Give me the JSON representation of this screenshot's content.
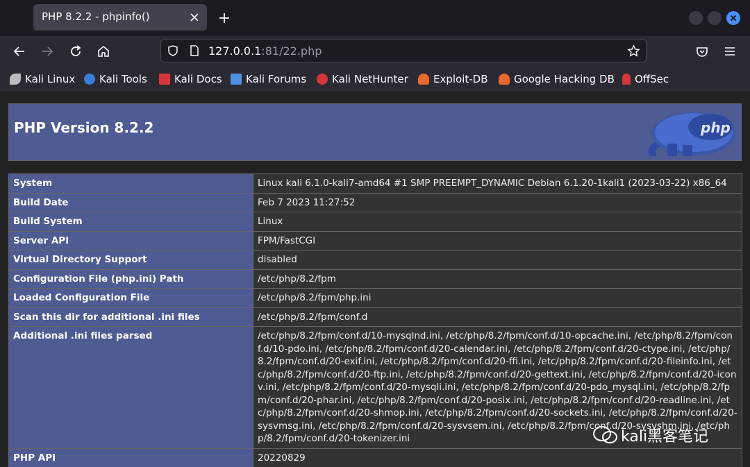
{
  "browser": {
    "tab_title": "PHP 8.2.2 - phpinfo()",
    "url_host": "127.0.0.1",
    "url_rest": ":81/22.php"
  },
  "bookmarks": [
    {
      "label": "Kali Linux",
      "icon": "kali-dragon-icon",
      "color": "#cccccc"
    },
    {
      "label": "Kali Tools",
      "icon": "kali-tools-icon",
      "color": "#3b7ddd"
    },
    {
      "label": "Kali Docs",
      "icon": "kali-docs-icon",
      "color": "#d6363b"
    },
    {
      "label": "Kali Forums",
      "icon": "kali-forums-icon",
      "color": "#4d8fe0"
    },
    {
      "label": "Kali NetHunter",
      "icon": "nethunter-icon",
      "color": "#d6363b"
    },
    {
      "label": "Exploit-DB",
      "icon": "exploit-db-icon",
      "color": "#e8692d"
    },
    {
      "label": "Google Hacking DB",
      "icon": "ghdb-icon",
      "color": "#e8692d"
    },
    {
      "label": "OffSec",
      "icon": "offsec-icon",
      "color": "#d6363b"
    }
  ],
  "page": {
    "heading": "PHP Version 8.2.2",
    "logo_text": "php",
    "rows": [
      {
        "key": "System",
        "value": "Linux kali 6.1.0-kali7-amd64 #1 SMP PREEMPT_DYNAMIC Debian 6.1.20-1kali1 (2023-03-22) x86_64"
      },
      {
        "key": "Build Date",
        "value": "Feb 7 2023 11:27:52"
      },
      {
        "key": "Build System",
        "value": "Linux"
      },
      {
        "key": "Server API",
        "value": "FPM/FastCGI"
      },
      {
        "key": "Virtual Directory Support",
        "value": "disabled"
      },
      {
        "key": "Configuration File (php.ini) Path",
        "value": "/etc/php/8.2/fpm"
      },
      {
        "key": "Loaded Configuration File",
        "value": "/etc/php/8.2/fpm/php.ini"
      },
      {
        "key": "Scan this dir for additional .ini files",
        "value": "/etc/php/8.2/fpm/conf.d"
      },
      {
        "key": "Additional .ini files parsed",
        "value": "/etc/php/8.2/fpm/conf.d/10-mysqlnd.ini, /etc/php/8.2/fpm/conf.d/10-opcache.ini, /etc/php/8.2/fpm/conf.d/10-pdo.ini, /etc/php/8.2/fpm/conf.d/20-calendar.ini, /etc/php/8.2/fpm/conf.d/20-ctype.ini, /etc/php/8.2/fpm/conf.d/20-exif.ini, /etc/php/8.2/fpm/conf.d/20-ffi.ini, /etc/php/8.2/fpm/conf.d/20-fileinfo.ini, /etc/php/8.2/fpm/conf.d/20-ftp.ini, /etc/php/8.2/fpm/conf.d/20-gettext.ini, /etc/php/8.2/fpm/conf.d/20-iconv.ini, /etc/php/8.2/fpm/conf.d/20-mysqli.ini, /etc/php/8.2/fpm/conf.d/20-pdo_mysql.ini, /etc/php/8.2/fpm/conf.d/20-phar.ini, /etc/php/8.2/fpm/conf.d/20-posix.ini, /etc/php/8.2/fpm/conf.d/20-readline.ini, /etc/php/8.2/fpm/conf.d/20-shmop.ini, /etc/php/8.2/fpm/conf.d/20-sockets.ini, /etc/php/8.2/fpm/conf.d/20-sysvmsg.ini, /etc/php/8.2/fpm/conf.d/20-sysvsem.ini, /etc/php/8.2/fpm/conf.d/20-sysvshm.ini, /etc/php/8.2/fpm/conf.d/20-tokenizer.ini"
      },
      {
        "key": "PHP API",
        "value": "20220829"
      }
    ]
  },
  "watermark": {
    "text": "kali黑客笔记"
  }
}
